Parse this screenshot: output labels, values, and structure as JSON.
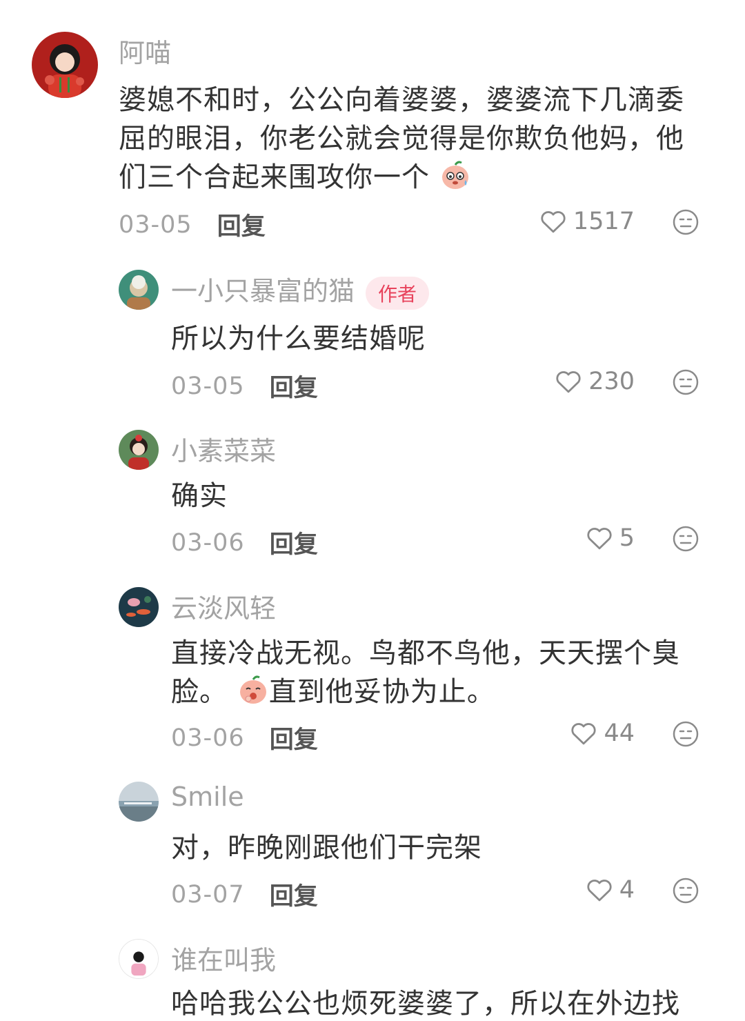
{
  "comments": [
    {
      "name": "阿喵",
      "lines": [
        "婆媳不和时，公公向着婆婆，婆婆流下几滴委",
        "屈的眼泪，你老公就会觉得是你欺负他妈，他",
        "们三个合起来围攻你一个"
      ],
      "date": "03-05",
      "reply_label": "回复",
      "likes": "1517"
    },
    {
      "name": "一小只暴富的猫",
      "badge": "作者",
      "lines": [
        "所以为什么要结婚呢"
      ],
      "date": "03-05",
      "reply_label": "回复",
      "likes": "230"
    },
    {
      "name": "小素菜菜",
      "lines": [
        "确实"
      ],
      "date": "03-06",
      "reply_label": "回复",
      "likes": "5"
    },
    {
      "name": "云淡风轻",
      "lines": [
        "直接冷战无视。鸟都不鸟他，天天摆个臭",
        "脸。",
        "直到他妥协为止。"
      ],
      "date": "03-06",
      "reply_label": "回复",
      "likes": "44"
    },
    {
      "name": "Smile",
      "lines": [
        "对，昨晚刚跟他们干完架"
      ],
      "date": "03-07",
      "reply_label": "回复",
      "likes": "4"
    },
    {
      "name": "谁在叫我",
      "lines": [
        "哈哈我公公也烦死婆婆了，所以在外边找"
      ]
    }
  ],
  "icons": {
    "like": "heart-outline-icon",
    "dislike": "meh-face-icon",
    "emoji": "peach-emoji"
  },
  "colors": {
    "name": "#a3a3a3",
    "text": "#333333",
    "badge_bg": "#fde8ec",
    "badge_text": "#e8435c"
  }
}
